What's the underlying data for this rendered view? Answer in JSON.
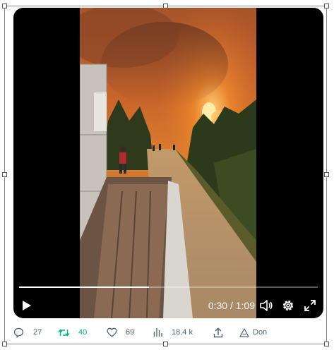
{
  "video": {
    "elapsed": "0:30",
    "duration": "1:09",
    "time_display": "0:30 / 1:09",
    "progress_fraction": 0.435
  },
  "actions": {
    "replies": "27",
    "reposts": "40",
    "likes": "69",
    "views": "18,4 k",
    "share_label": "Don"
  },
  "icons": {
    "play": "play-icon",
    "volume": "volume-icon",
    "settings": "gear-icon",
    "fullscreen": "expand-icon",
    "reply": "reply-icon",
    "repost": "repost-icon",
    "like": "heart-icon",
    "views": "bar-chart-icon",
    "share": "share-icon",
    "translate": "translate-icon"
  },
  "colors": {
    "repost_active": "#00ba7c",
    "secondary_text": "#536471",
    "player_bg": "#000000"
  }
}
